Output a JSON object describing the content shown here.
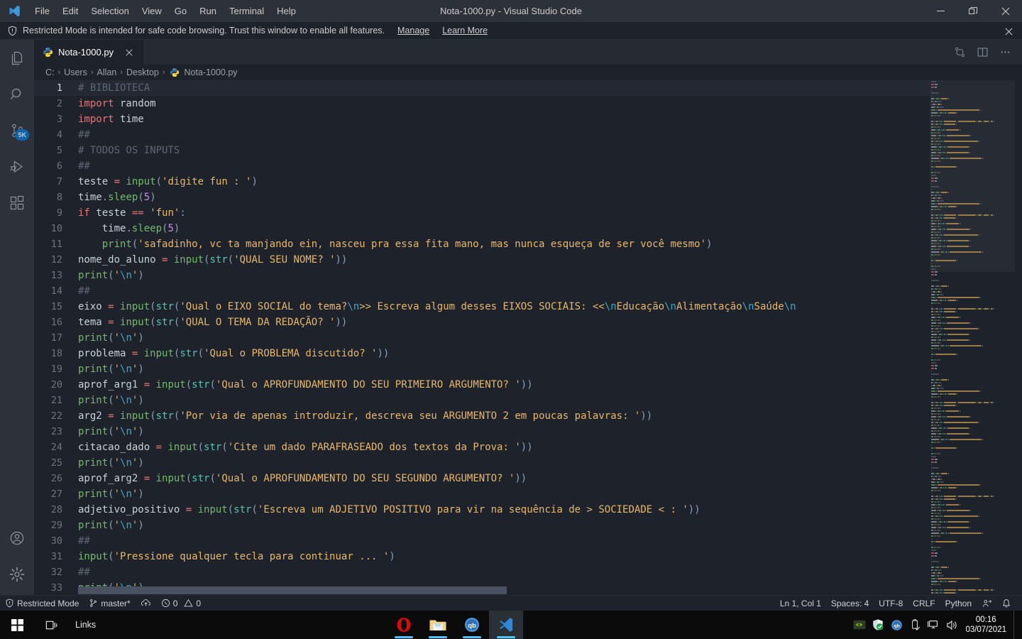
{
  "titlebar": {
    "logo_icon": "vscode-logo-icon",
    "window_title": "Nota-1000.py - Visual Studio Code",
    "menus": [
      "File",
      "Edit",
      "Selection",
      "View",
      "Go",
      "Run",
      "Terminal",
      "Help"
    ],
    "controls": {
      "minimize": "minimize-icon",
      "restore": "restore-icon",
      "close": "close-icon"
    }
  },
  "banner": {
    "shield_icon": "shield-icon",
    "message": "Restricted Mode is intended for safe code browsing. Trust this window to enable all features.",
    "manage_label": "Manage",
    "learn_more_label": "Learn More",
    "close_icon": "close-icon"
  },
  "activitybar": {
    "items": [
      {
        "name": "explorer",
        "icon": "files-icon",
        "badge": null
      },
      {
        "name": "search",
        "icon": "search-icon",
        "badge": null
      },
      {
        "name": "source-control",
        "icon": "source-control-icon",
        "badge": "5K"
      },
      {
        "name": "run-and-debug",
        "icon": "run-debug-icon",
        "badge": null
      },
      {
        "name": "extensions",
        "icon": "extensions-icon",
        "badge": null
      }
    ],
    "bottom": [
      {
        "name": "accounts",
        "icon": "account-icon"
      },
      {
        "name": "manage",
        "icon": "gear-icon"
      }
    ]
  },
  "tabs": [
    {
      "label": "Nota-1000.py",
      "icon": "python-file-icon",
      "active": true,
      "close_icon": "close-icon"
    }
  ],
  "editor_actions": [
    {
      "name": "open-changes",
      "icon": "compare-changes-icon"
    },
    {
      "name": "split-editor",
      "icon": "split-editor-icon"
    },
    {
      "name": "more-actions",
      "icon": "ellipsis-icon"
    }
  ],
  "breadcrumb": {
    "segments": [
      "C:",
      "Users",
      "Allan",
      "Desktop"
    ],
    "file": "Nota-1000.py",
    "file_icon": "python-file-icon",
    "separator": "›"
  },
  "editor": {
    "active_line": 1,
    "lines": [
      {
        "n": 1,
        "tokens": [
          [
            "cmt",
            "# BIBLIOTECA"
          ]
        ]
      },
      {
        "n": 2,
        "tokens": [
          [
            "kw",
            "import"
          ],
          [
            "var",
            " random"
          ]
        ]
      },
      {
        "n": 3,
        "tokens": [
          [
            "kw",
            "import"
          ],
          [
            "var",
            " time"
          ]
        ]
      },
      {
        "n": 4,
        "tokens": [
          [
            "cmt",
            "##"
          ]
        ]
      },
      {
        "n": 5,
        "tokens": [
          [
            "cmt",
            "# TODOS OS INPUTS"
          ]
        ]
      },
      {
        "n": 6,
        "tokens": [
          [
            "cmt",
            "##"
          ]
        ]
      },
      {
        "n": 7,
        "tokens": [
          [
            "var",
            "teste "
          ],
          [
            "op",
            "="
          ],
          [
            "fn",
            " input"
          ],
          [
            "pun",
            "("
          ],
          [
            "str",
            "'digite fun : '"
          ],
          [
            "pun",
            ")"
          ]
        ]
      },
      {
        "n": 8,
        "tokens": [
          [
            "var",
            "time"
          ],
          [
            "pun",
            "."
          ],
          [
            "fn",
            "sleep"
          ],
          [
            "pun",
            "("
          ],
          [
            "num",
            "5"
          ],
          [
            "pun",
            ")"
          ]
        ]
      },
      {
        "n": 9,
        "tokens": [
          [
            "kw",
            "if"
          ],
          [
            "var",
            " teste "
          ],
          [
            "op",
            "=="
          ],
          [
            "str",
            " 'fun'"
          ],
          [
            "pun",
            ":"
          ]
        ]
      },
      {
        "n": 10,
        "tokens": [
          [
            "var",
            "    time"
          ],
          [
            "pun",
            "."
          ],
          [
            "fn",
            "sleep"
          ],
          [
            "pun",
            "("
          ],
          [
            "num",
            "5"
          ],
          [
            "pun",
            ")"
          ]
        ]
      },
      {
        "n": 11,
        "tokens": [
          [
            "fn",
            "    print"
          ],
          [
            "pun",
            "("
          ],
          [
            "str",
            "'safadinho, vc ta manjando ein, nasceu pra essa fita mano, mas nunca esqueça de ser você mesmo'"
          ],
          [
            "pun",
            ")"
          ]
        ]
      },
      {
        "n": 12,
        "tokens": [
          [
            "var",
            "nome_do_aluno "
          ],
          [
            "op",
            "="
          ],
          [
            "fn",
            " input"
          ],
          [
            "pun",
            "("
          ],
          [
            "bi",
            "str"
          ],
          [
            "pun",
            "("
          ],
          [
            "str",
            "'QUAL SEU NOME? '"
          ],
          [
            "pun",
            "))"
          ]
        ]
      },
      {
        "n": 13,
        "tokens": [
          [
            "fn",
            "print"
          ],
          [
            "pun",
            "("
          ],
          [
            "str",
            "'"
          ],
          [
            "esc",
            "\\n"
          ],
          [
            "str",
            "'"
          ],
          [
            "pun",
            ")"
          ]
        ]
      },
      {
        "n": 14,
        "tokens": [
          [
            "cmt",
            "##"
          ]
        ]
      },
      {
        "n": 15,
        "tokens": [
          [
            "var",
            "eixo "
          ],
          [
            "op",
            "="
          ],
          [
            "fn",
            " input"
          ],
          [
            "pun",
            "("
          ],
          [
            "bi",
            "str"
          ],
          [
            "pun",
            "("
          ],
          [
            "str",
            "'Qual o EIXO SOCIAL do tema?"
          ],
          [
            "esc",
            "\\n"
          ],
          [
            "str",
            ">> Escreva algum desses EIXOS SOCIAIS: <<"
          ],
          [
            "esc",
            "\\n"
          ],
          [
            "str",
            "Educação"
          ],
          [
            "esc",
            "\\n"
          ],
          [
            "str",
            "Alimentação"
          ],
          [
            "esc",
            "\\n"
          ],
          [
            "str",
            "Saúde"
          ],
          [
            "esc",
            "\\n"
          ]
        ]
      },
      {
        "n": 16,
        "tokens": [
          [
            "var",
            "tema "
          ],
          [
            "op",
            "="
          ],
          [
            "fn",
            " input"
          ],
          [
            "pun",
            "("
          ],
          [
            "bi",
            "str"
          ],
          [
            "pun",
            "("
          ],
          [
            "str",
            "'QUAL O TEMA DA REDAÇÃO? '"
          ],
          [
            "pun",
            "))"
          ]
        ]
      },
      {
        "n": 17,
        "tokens": [
          [
            "fn",
            "print"
          ],
          [
            "pun",
            "("
          ],
          [
            "str",
            "'"
          ],
          [
            "esc",
            "\\n"
          ],
          [
            "str",
            "'"
          ],
          [
            "pun",
            ")"
          ]
        ]
      },
      {
        "n": 18,
        "tokens": [
          [
            "var",
            "problema "
          ],
          [
            "op",
            "="
          ],
          [
            "fn",
            " input"
          ],
          [
            "pun",
            "("
          ],
          [
            "bi",
            "str"
          ],
          [
            "pun",
            "("
          ],
          [
            "str",
            "'Qual o PROBLEMA discutido? '"
          ],
          [
            "pun",
            "))"
          ]
        ]
      },
      {
        "n": 19,
        "tokens": [
          [
            "fn",
            "print"
          ],
          [
            "pun",
            "("
          ],
          [
            "str",
            "'"
          ],
          [
            "esc",
            "\\n"
          ],
          [
            "str",
            "'"
          ],
          [
            "pun",
            ")"
          ]
        ]
      },
      {
        "n": 20,
        "tokens": [
          [
            "var",
            "aprof_arg1 "
          ],
          [
            "op",
            "="
          ],
          [
            "fn",
            " input"
          ],
          [
            "pun",
            "("
          ],
          [
            "bi",
            "str"
          ],
          [
            "pun",
            "("
          ],
          [
            "str",
            "'Qual o APROFUNDAMENTO DO SEU PRIMEIRO ARGUMENTO? '"
          ],
          [
            "pun",
            "))"
          ]
        ]
      },
      {
        "n": 21,
        "tokens": [
          [
            "fn",
            "print"
          ],
          [
            "pun",
            "("
          ],
          [
            "str",
            "'"
          ],
          [
            "esc",
            "\\n"
          ],
          [
            "str",
            "'"
          ],
          [
            "pun",
            ")"
          ]
        ]
      },
      {
        "n": 22,
        "tokens": [
          [
            "var",
            "arg2 "
          ],
          [
            "op",
            "="
          ],
          [
            "fn",
            " input"
          ],
          [
            "pun",
            "("
          ],
          [
            "bi",
            "str"
          ],
          [
            "pun",
            "("
          ],
          [
            "str",
            "'Por via de apenas introduzir, descreva seu ARGUMENTO 2 em poucas palavras: '"
          ],
          [
            "pun",
            "))"
          ]
        ]
      },
      {
        "n": 23,
        "tokens": [
          [
            "fn",
            "print"
          ],
          [
            "pun",
            "("
          ],
          [
            "str",
            "'"
          ],
          [
            "esc",
            "\\n"
          ],
          [
            "str",
            "'"
          ],
          [
            "pun",
            ")"
          ]
        ]
      },
      {
        "n": 24,
        "tokens": [
          [
            "var",
            "citacao_dado "
          ],
          [
            "op",
            "="
          ],
          [
            "fn",
            " input"
          ],
          [
            "pun",
            "("
          ],
          [
            "bi",
            "str"
          ],
          [
            "pun",
            "("
          ],
          [
            "str",
            "'Cite um dado PARAFRASEADO dos textos da Prova: '"
          ],
          [
            "pun",
            "))"
          ]
        ]
      },
      {
        "n": 25,
        "tokens": [
          [
            "fn",
            "print"
          ],
          [
            "pun",
            "("
          ],
          [
            "str",
            "'"
          ],
          [
            "esc",
            "\\n"
          ],
          [
            "str",
            "'"
          ],
          [
            "pun",
            ")"
          ]
        ]
      },
      {
        "n": 26,
        "tokens": [
          [
            "var",
            "aprof_arg2 "
          ],
          [
            "op",
            "="
          ],
          [
            "fn",
            " input"
          ],
          [
            "pun",
            "("
          ],
          [
            "bi",
            "str"
          ],
          [
            "pun",
            "("
          ],
          [
            "str",
            "'Qual o APROFUNDAMENTO DO SEU SEGUNDO ARGUMENTO? '"
          ],
          [
            "pun",
            "))"
          ]
        ]
      },
      {
        "n": 27,
        "tokens": [
          [
            "fn",
            "print"
          ],
          [
            "pun",
            "("
          ],
          [
            "str",
            "'"
          ],
          [
            "esc",
            "\\n"
          ],
          [
            "str",
            "'"
          ],
          [
            "pun",
            ")"
          ]
        ]
      },
      {
        "n": 28,
        "tokens": [
          [
            "var",
            "adjetivo_positivo "
          ],
          [
            "op",
            "="
          ],
          [
            "fn",
            " input"
          ],
          [
            "pun",
            "("
          ],
          [
            "bi",
            "str"
          ],
          [
            "pun",
            "("
          ],
          [
            "str",
            "'Escreva um ADJETIVO POSITIVO para vir na sequência de > SOCIEDADE < : '"
          ],
          [
            "pun",
            "))"
          ]
        ]
      },
      {
        "n": 29,
        "tokens": [
          [
            "fn",
            "print"
          ],
          [
            "pun",
            "("
          ],
          [
            "str",
            "'"
          ],
          [
            "esc",
            "\\n"
          ],
          [
            "str",
            "'"
          ],
          [
            "pun",
            ")"
          ]
        ]
      },
      {
        "n": 30,
        "tokens": [
          [
            "cmt",
            "##"
          ]
        ]
      },
      {
        "n": 31,
        "tokens": [
          [
            "fn",
            "input"
          ],
          [
            "pun",
            "("
          ],
          [
            "str",
            "'Pressione qualquer tecla para continuar ... '"
          ],
          [
            "pun",
            ")"
          ]
        ]
      },
      {
        "n": 32,
        "tokens": [
          [
            "cmt",
            "##"
          ]
        ]
      },
      {
        "n": 33,
        "tokens": [
          [
            "fn",
            "print"
          ],
          [
            "pun",
            "("
          ],
          [
            "str",
            "'"
          ],
          [
            "esc",
            "\\n"
          ],
          [
            "str",
            "'"
          ],
          [
            "pun",
            ")"
          ]
        ]
      }
    ]
  },
  "statusbar": {
    "left": [
      {
        "name": "restricted-mode",
        "icon": "shield-icon",
        "label": "Restricted Mode"
      },
      {
        "name": "git-branch",
        "icon": "source-control-icon",
        "label": "master*"
      },
      {
        "name": "sync-changes",
        "icon": "cloud-upload-icon",
        "label": ""
      },
      {
        "name": "problems",
        "icon": "error-warning-icon",
        "label": "0  0",
        "errors": "0",
        "warnings": "0"
      }
    ],
    "right": [
      {
        "name": "cursor-position",
        "label": "Ln 1, Col 1"
      },
      {
        "name": "indentation",
        "label": "Spaces: 4"
      },
      {
        "name": "encoding",
        "label": "UTF-8"
      },
      {
        "name": "eol",
        "label": "CRLF"
      },
      {
        "name": "language-mode",
        "label": "Python"
      },
      {
        "name": "feedback",
        "icon": "feedback-icon",
        "label": ""
      },
      {
        "name": "notifications",
        "icon": "bell-icon",
        "label": ""
      }
    ]
  },
  "taskbar": {
    "start_icon": "windows-start-icon",
    "taskview_icon": "task-view-icon",
    "links_label": "Links",
    "apps": [
      {
        "name": "opera",
        "icon": "opera-icon",
        "active": false
      },
      {
        "name": "file-explorer",
        "icon": "folder-icon",
        "active": false
      },
      {
        "name": "qbittorrent",
        "icon": "qbittorrent-icon",
        "active": false
      },
      {
        "name": "visual-studio-code",
        "icon": "vscode-icon",
        "active": true
      }
    ],
    "tray": [
      {
        "name": "nvidia",
        "icon": "nvidia-icon"
      },
      {
        "name": "windows-security",
        "icon": "security-shield-icon"
      },
      {
        "name": "qbittorrent-tray",
        "icon": "qbittorrent-icon"
      },
      {
        "name": "safely-remove-hardware",
        "icon": "usb-eject-icon"
      },
      {
        "name": "network",
        "icon": "network-icon"
      },
      {
        "name": "volume",
        "icon": "speaker-icon"
      }
    ],
    "clock": {
      "time": "00:16",
      "date": "03/07/2021"
    }
  },
  "colors": {
    "titlebar_bg": "#2c313a",
    "editor_bg": "#1e222a",
    "accent": "#0078d4",
    "taskbar_active": "#4cc2ff",
    "string": "#e8b86b",
    "keyword": "#f07178",
    "function": "#74b96f",
    "comment": "#5f6672",
    "escape": "#3fa7c7"
  }
}
